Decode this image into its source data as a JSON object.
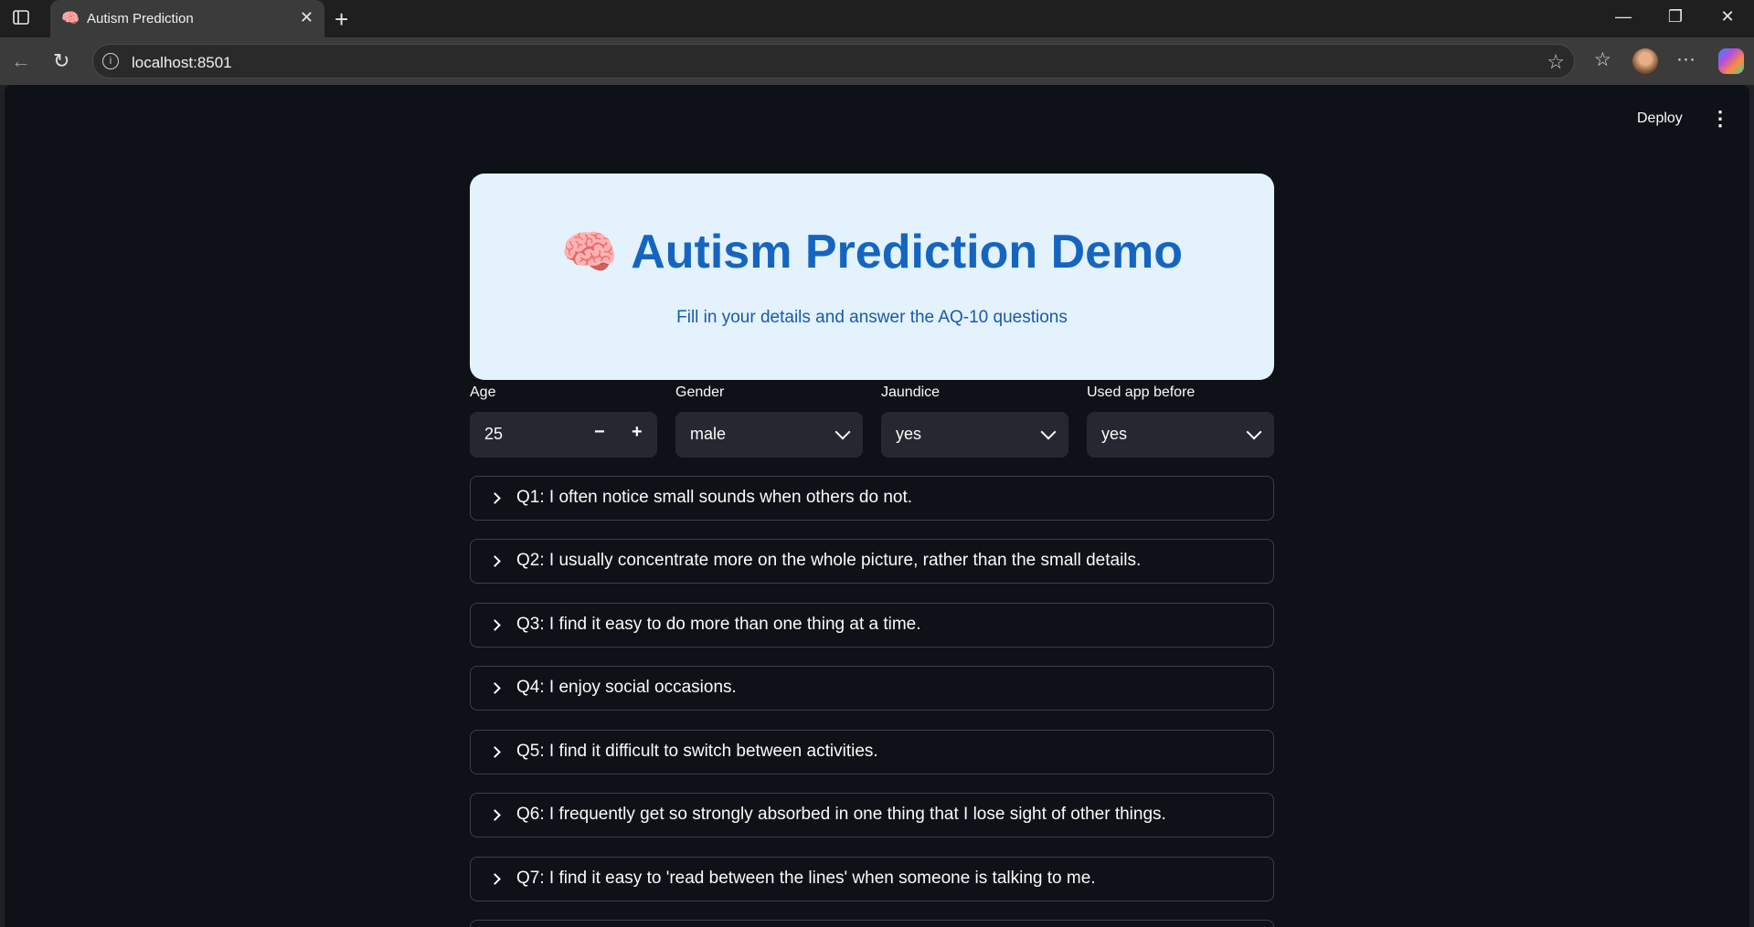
{
  "browser": {
    "tab_title": "Autism Prediction",
    "tab_favicon": "🧠",
    "url": "localhost:8501"
  },
  "app": {
    "deploy_label": "Deploy",
    "hero": {
      "emoji": "🧠",
      "title": "Autism Prediction Demo",
      "subtitle": "Fill in your details and answer the AQ-10 questions"
    },
    "inputs": {
      "age": {
        "label": "Age",
        "value": "25"
      },
      "gender": {
        "label": "Gender",
        "value": "male"
      },
      "jaundice": {
        "label": "Jaundice",
        "value": "yes"
      },
      "used_app_before": {
        "label": "Used app before",
        "value": "yes"
      }
    },
    "questions": [
      "Q1: I often notice small sounds when others do not.",
      "Q2: I usually concentrate more on the whole picture, rather than the small details.",
      "Q3: I find it easy to do more than one thing at a time.",
      "Q4: I enjoy social occasions.",
      "Q5: I find it difficult to switch between activities.",
      "Q6: I frequently get so strongly absorbed in one thing that I lose sight of other things.",
      "Q7: I find it easy to 'read between the lines' when someone is talking to me."
    ]
  },
  "colors": {
    "app_background": "#0e1117",
    "hero_background": "#e3f2fd",
    "hero_title": "#1565c0",
    "input_background": "#262730"
  }
}
